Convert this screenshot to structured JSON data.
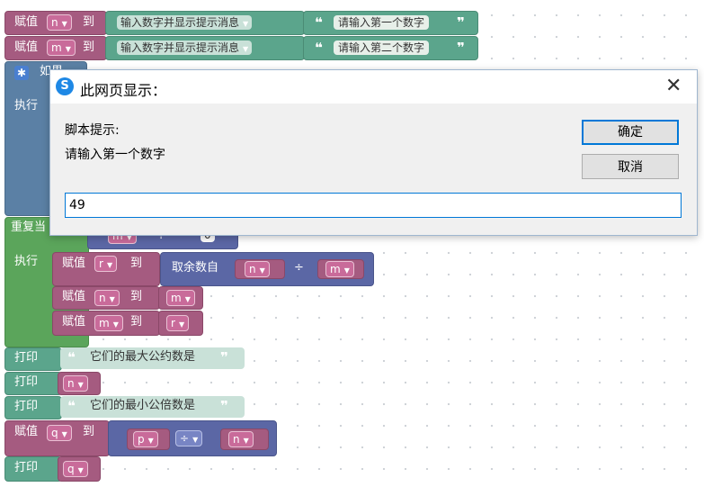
{
  "blocks": {
    "assign_label": "赋值",
    "to_label": "到",
    "prompt_block": "输入数字并显示提示消息",
    "prompt1": "请输入第一个数字",
    "prompt2": "请输入第二个数字",
    "var_n": "n",
    "var_m": "m",
    "var_r": "r",
    "var_p": "p",
    "var_q": "q",
    "if_label": "如果",
    "do_label": "执行",
    "repeat_label": "重复当",
    "do2_label": "执行",
    "remainder_label": "取余数自",
    "divide_op": "÷",
    "print_label": "打印",
    "gcd_text": "它们的最大公约数是",
    "lcm_text": "它们的最小公倍数是",
    "partial_left": "m",
    "partial_mid": "?",
    "partial_right": "0"
  },
  "dialog": {
    "title": "此网页显示：",
    "message_label": "脚本提示:",
    "message": "请输入第一个数字",
    "ok_label": "确定",
    "cancel_label": "取消",
    "input_value": "49",
    "close_icon": "close-icon",
    "logo_icon": "browser-logo-icon"
  },
  "colors": {
    "variable": "#a55b80",
    "text": "#5ba58c",
    "control": "#5ba55b",
    "math": "#5b67a5",
    "accent": "#0078d7"
  }
}
